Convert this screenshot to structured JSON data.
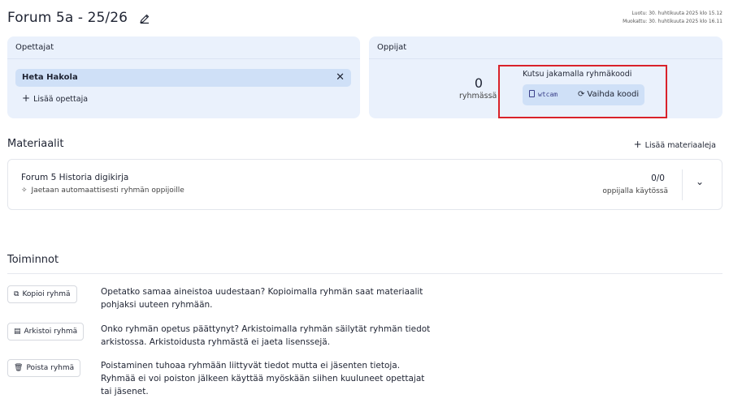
{
  "header": {
    "title": "Forum 5a - 25/26",
    "created": "Luotu: 30. huhtikuuta 2025 klo 15.12",
    "modified": "Muokattu: 30. huhtikuuta 2025 klo 16.11"
  },
  "teachers": {
    "title": "Opettajat",
    "chip": "Heta Hakola",
    "add_label": "Lisää opettaja"
  },
  "learners": {
    "title": "Oppijat",
    "count": "0",
    "count_label": "ryhmässä",
    "invite_title": "Kutsu jakamalla ryhmäkoodi",
    "code": "wtcam",
    "change_code_label": "Vaihda koodi"
  },
  "materials": {
    "title": "Materiaalit",
    "add_label": "Lisää materiaaleja",
    "items": [
      {
        "name": "Forum 5 Historia digikirja",
        "subtitle": "Jaetaan automaattisesti ryhmän oppijoille",
        "count": "0/0",
        "count_label": "oppijalla käytössä"
      }
    ]
  },
  "actions": {
    "title": "Toiminnot",
    "items": [
      {
        "label": "Kopioi ryhmä",
        "icon": "copy-icon",
        "description": "Opetatko samaa aineistoa uudestaan? Kopioimalla ryhmän saat materiaalit pohjaksi uuteen ryhmään."
      },
      {
        "label": "Arkistoi ryhmä",
        "icon": "archive-icon",
        "description": "Onko ryhmän opetus päättynyt? Arkistoimalla ryhmän säilytät ryhmän tiedot arkistossa. Arkistoidusta ryhmästä ei jaeta lisenssejä."
      },
      {
        "label": "Poista ryhmä",
        "icon": "trash-icon",
        "description": "Poistaminen tuhoaa ryhmään liittyvät tiedot mutta ei jäsenten tietoja. Ryhmää ei voi poiston jälkeen käyttää myöskään siihen kuuluneet opettajat tai jäsenet."
      }
    ]
  },
  "colors": {
    "card_bg": "#eaf1fc",
    "chip_bg": "#cfe0f7",
    "highlight_border": "#d9222a"
  }
}
